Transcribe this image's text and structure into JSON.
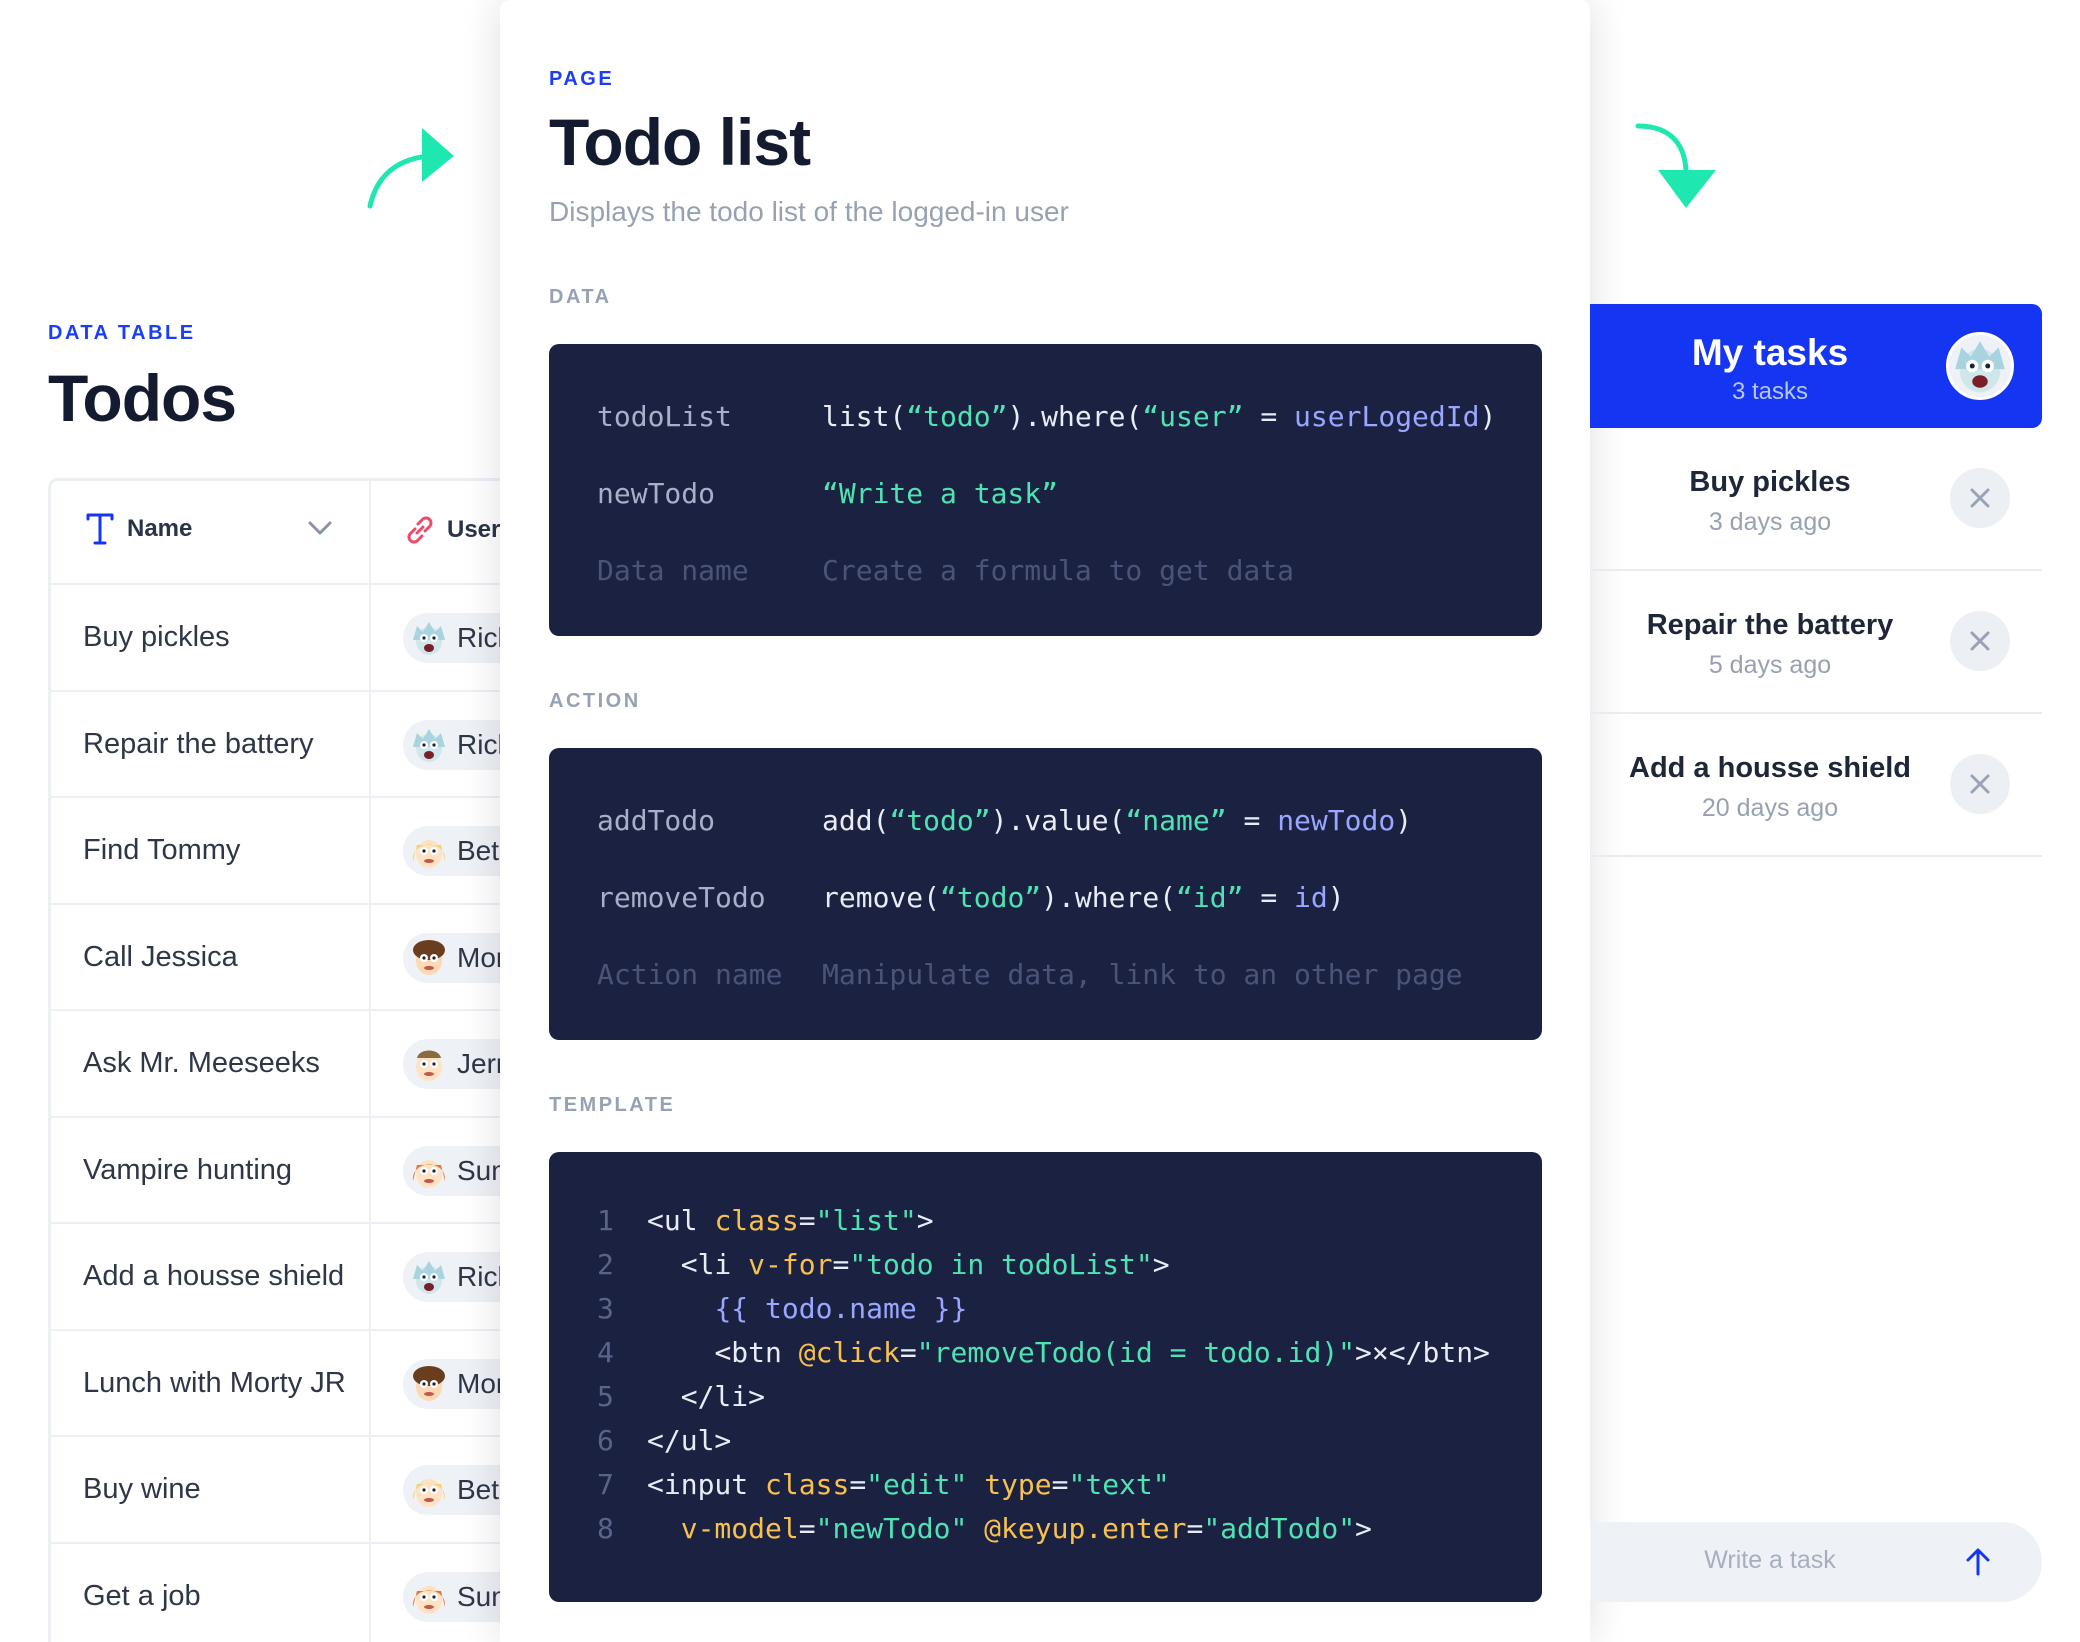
{
  "colors": {
    "accent": "#1436f2",
    "code_bg": "#1b2140",
    "arrow": "#1ee8b0",
    "string": "#4fe3b4",
    "attribute": "#f7c04f",
    "variable": "#9aa6ff"
  },
  "table_panel": {
    "eyebrow": "DATA TABLE",
    "title": "Todos",
    "columns": [
      {
        "label": "Name",
        "icon": "text-type-icon"
      },
      {
        "label": "User",
        "icon": "link-icon"
      }
    ],
    "rows": [
      {
        "name": "Buy pickles",
        "user": "Rick",
        "avatar": "rick"
      },
      {
        "name": "Repair the battery",
        "user": "Rick",
        "avatar": "rick"
      },
      {
        "name": "Find Tommy",
        "user": "Beth",
        "avatar": "beth"
      },
      {
        "name": "Call Jessica",
        "user": "Morty",
        "avatar": "morty"
      },
      {
        "name": "Ask Mr. Meeseeks",
        "user": "Jerry",
        "avatar": "jerry"
      },
      {
        "name": "Vampire hunting",
        "user": "Summer",
        "avatar": "summer"
      },
      {
        "name": "Add a housse shield",
        "user": "Rick",
        "avatar": "rick"
      },
      {
        "name": "Lunch with Morty JR",
        "user": "Morty",
        "avatar": "morty"
      },
      {
        "name": "Buy wine",
        "user": "Beth",
        "avatar": "beth"
      },
      {
        "name": "Get a job",
        "user": "Summer",
        "avatar": "summer"
      }
    ]
  },
  "page_panel": {
    "eyebrow": "PAGE",
    "title": "Todo list",
    "subtitle": "Displays the todo list of the logged-in user",
    "data_label": "DATA",
    "data_rows": [
      {
        "key": "todoList",
        "value": "list(“todo”).where(“user” = userLogedId)"
      },
      {
        "key": "newTodo",
        "value": "“Write a task”"
      }
    ],
    "data_placeholder": {
      "key": "Data name",
      "value": "Create a formula to get data"
    },
    "action_label": "ACTION",
    "action_rows": [
      {
        "key": "addTodo",
        "value": "add(“todo”).value(“name” = newTodo)"
      },
      {
        "key": "removeTodo",
        "value": "remove(“todo”).where(“id” = id)"
      }
    ],
    "action_placeholder": {
      "key": "Action name",
      "value": "Manipulate data, link to an other page"
    },
    "template_label": "TEMPLATE",
    "template_lines": [
      "<ul class=\"list\">",
      "  <li v-for=\"todo in todoList\">",
      "    {{ todo.name }}",
      "    <btn @click=\"removeTodo(id = todo.id)\">×</btn>",
      "  </li>",
      "</ul>",
      "<input class=\"edit\" type=\"text\"",
      "  v-model=\"newTodo\" @keyup.enter=\"addTodo\">"
    ]
  },
  "preview_panel": {
    "title": "My tasks",
    "count": "3 tasks",
    "tasks": [
      {
        "name": "Buy pickles",
        "date": "3 days ago"
      },
      {
        "name": "Repair the battery",
        "date": "5 days ago"
      },
      {
        "name": "Add a housse shield",
        "date": "20 days ago"
      }
    ],
    "input_placeholder": "Write a task",
    "send_icon": "arrow-up-icon",
    "delete_icon": "close-icon"
  }
}
